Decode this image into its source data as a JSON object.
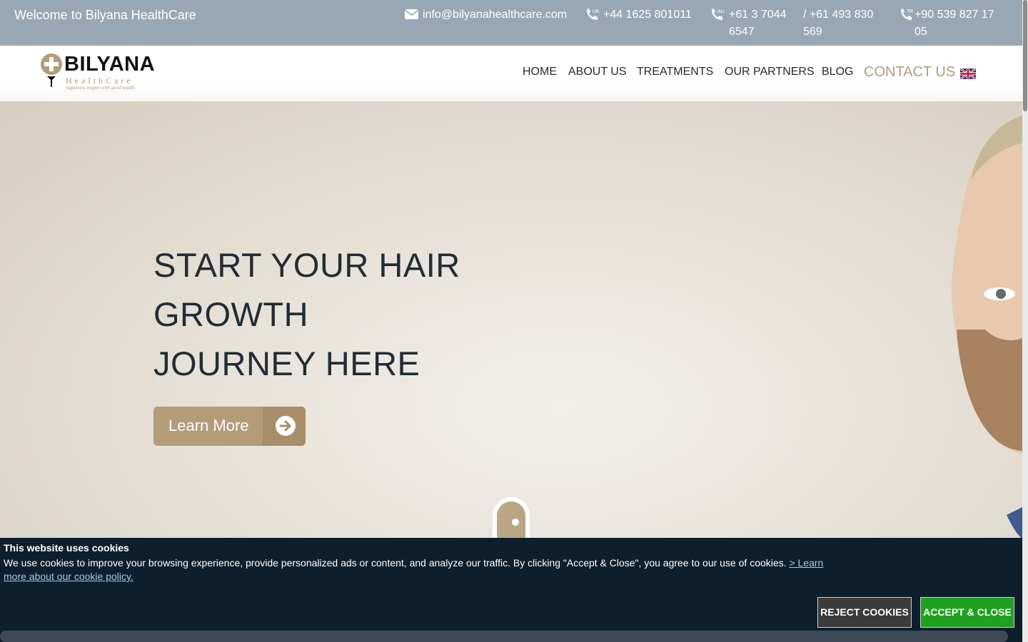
{
  "topbar": {
    "welcome": "Welcome to Bilyana HealthCare",
    "email": "info@bilyanahealthcare.com",
    "phone_uk": "+44 1625 801011",
    "phone_au_1": "+61 3 7044 6547",
    "phone_au_2": "/ +61 493 830 569",
    "phone_tr": "+90 539 827 17 05",
    "badge_uk": "UK",
    "badge_au": "AU",
    "badge_tr": "TR"
  },
  "logo": {
    "brand": "BILYANA",
    "sub": "HealthCare",
    "tagline": "happiness begins with good health"
  },
  "nav": {
    "home": "HOME",
    "about": "ABOUT US",
    "treatments": "TREATMENTS",
    "partners": "OUR PARTNERS",
    "blog": "BLOG",
    "contact": "CONTACT US"
  },
  "hero": {
    "line1": "START YOUR HAIR",
    "line2": "GROWTH",
    "line3": "JOURNEY HERE",
    "button": "Learn More"
  },
  "cookie": {
    "title": "This website uses cookies",
    "text": "We use cookies to improve your browsing experience, provide personalized ads or content, and analyze our traffic. By clicking \"Accept & Close\", you agree to our use of cookies.",
    "link": "> Learn more about our cookie policy.",
    "reject": "REJECT COOKIES",
    "accept": "ACCEPT & CLOSE"
  },
  "colors": {
    "topbar_bg": "#97a8b4",
    "accent_gold": "#b49c78",
    "cookie_bg": "#0d1f2d",
    "accept_green": "#1fa11f"
  },
  "icons": [
    "envelope-icon",
    "phone-uk-icon",
    "phone-au-icon",
    "phone-tr-icon",
    "uk-flag-icon",
    "arrow-right-circle-icon",
    "scroll-mouse-icon"
  ]
}
